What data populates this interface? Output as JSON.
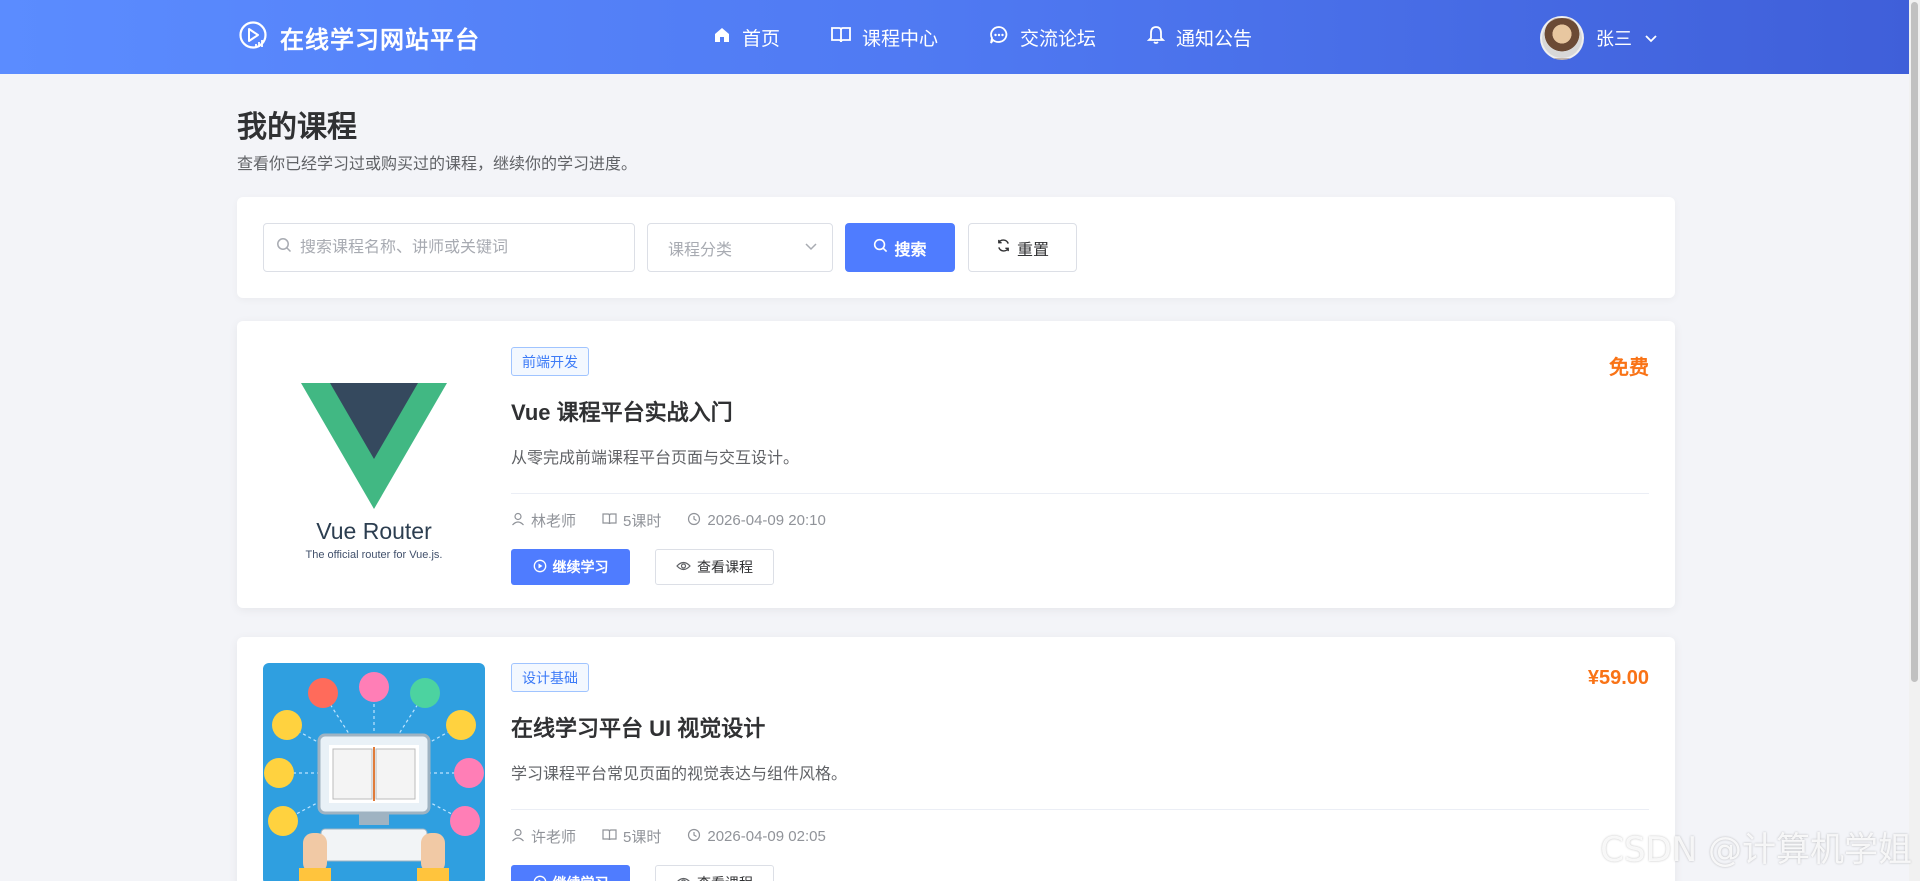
{
  "brand": {
    "title": "在线学习网站平台"
  },
  "nav": {
    "items": [
      {
        "label": "首页",
        "icon": "home-icon"
      },
      {
        "label": "课程中心",
        "icon": "book-icon"
      },
      {
        "label": "交流论坛",
        "icon": "chat-icon"
      },
      {
        "label": "通知公告",
        "icon": "bell-icon"
      }
    ]
  },
  "user": {
    "name": "张三"
  },
  "page": {
    "title": "我的课程",
    "subtitle": "查看你已经学习过或购买过的课程，继续你的学习进度。"
  },
  "filter": {
    "search_placeholder": "搜索课程名称、讲师或关键词",
    "search_value": "",
    "category_placeholder": "课程分类",
    "search_label": "搜索",
    "reset_label": "重置"
  },
  "courses": [
    {
      "tag": "前端开发",
      "title": "Vue 课程平台实战入门",
      "desc": "从零完成前端课程平台页面与交互设计。",
      "teacher": "林老师",
      "lessons": "5课时",
      "time": "2026-04-09 20:10",
      "price": "免费",
      "cover_title": "Vue Router",
      "cover_sub": "The official router for Vue.js.",
      "continue_label": "继续学习",
      "view_label": "查看课程"
    },
    {
      "tag": "设计基础",
      "title": "在线学习平台 UI 视觉设计",
      "desc": "学习课程平台常见页面的视觉表达与组件风格。",
      "teacher": "许老师",
      "lessons": "5课时",
      "time": "2026-04-09 02:05",
      "price": "¥59.00",
      "continue_label": "继续学习",
      "view_label": "查看课程"
    }
  ],
  "watermark": "CSDN @计算机学姐",
  "colors": {
    "primary": "#4f7cff",
    "price": "#f97316",
    "header_start": "#5b8cff",
    "header_end": "#3f5fd9"
  }
}
